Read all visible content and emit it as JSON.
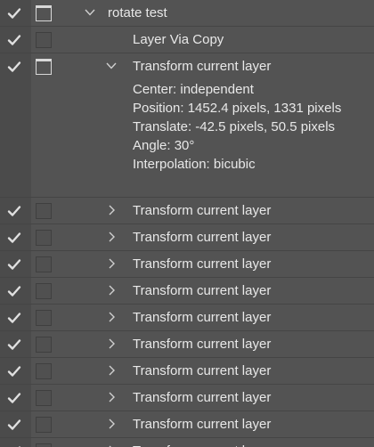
{
  "rows": [
    {
      "label": "rotate test",
      "dialog_on": true,
      "twirl": "open"
    },
    {
      "label": "Layer Via Copy",
      "dialog_on": false,
      "twirl": "none"
    },
    {
      "label": "Transform current layer",
      "dialog_on": true,
      "twirl": "open"
    }
  ],
  "details": [
    "Center: independent",
    "Position: 1452.4 pixels, 1331 pixels",
    "Translate: -42.5 pixels, 50.5 pixels",
    "Angle: 30°",
    "Interpolation: bicubic"
  ],
  "collapsed_rows": [
    {
      "label": "Transform current layer"
    },
    {
      "label": "Transform current layer"
    },
    {
      "label": "Transform current layer"
    },
    {
      "label": "Transform current layer"
    },
    {
      "label": "Transform current layer"
    },
    {
      "label": "Transform current layer"
    },
    {
      "label": "Transform current layer"
    },
    {
      "label": "Transform current layer"
    },
    {
      "label": "Transform current layer"
    },
    {
      "label": "Transform current layer"
    }
  ],
  "colors": {
    "panel_bg": "#535353",
    "gutter_bg": "#4b4b4b",
    "text": "#e8e8e8",
    "checkmark": "#e0e0e0"
  }
}
